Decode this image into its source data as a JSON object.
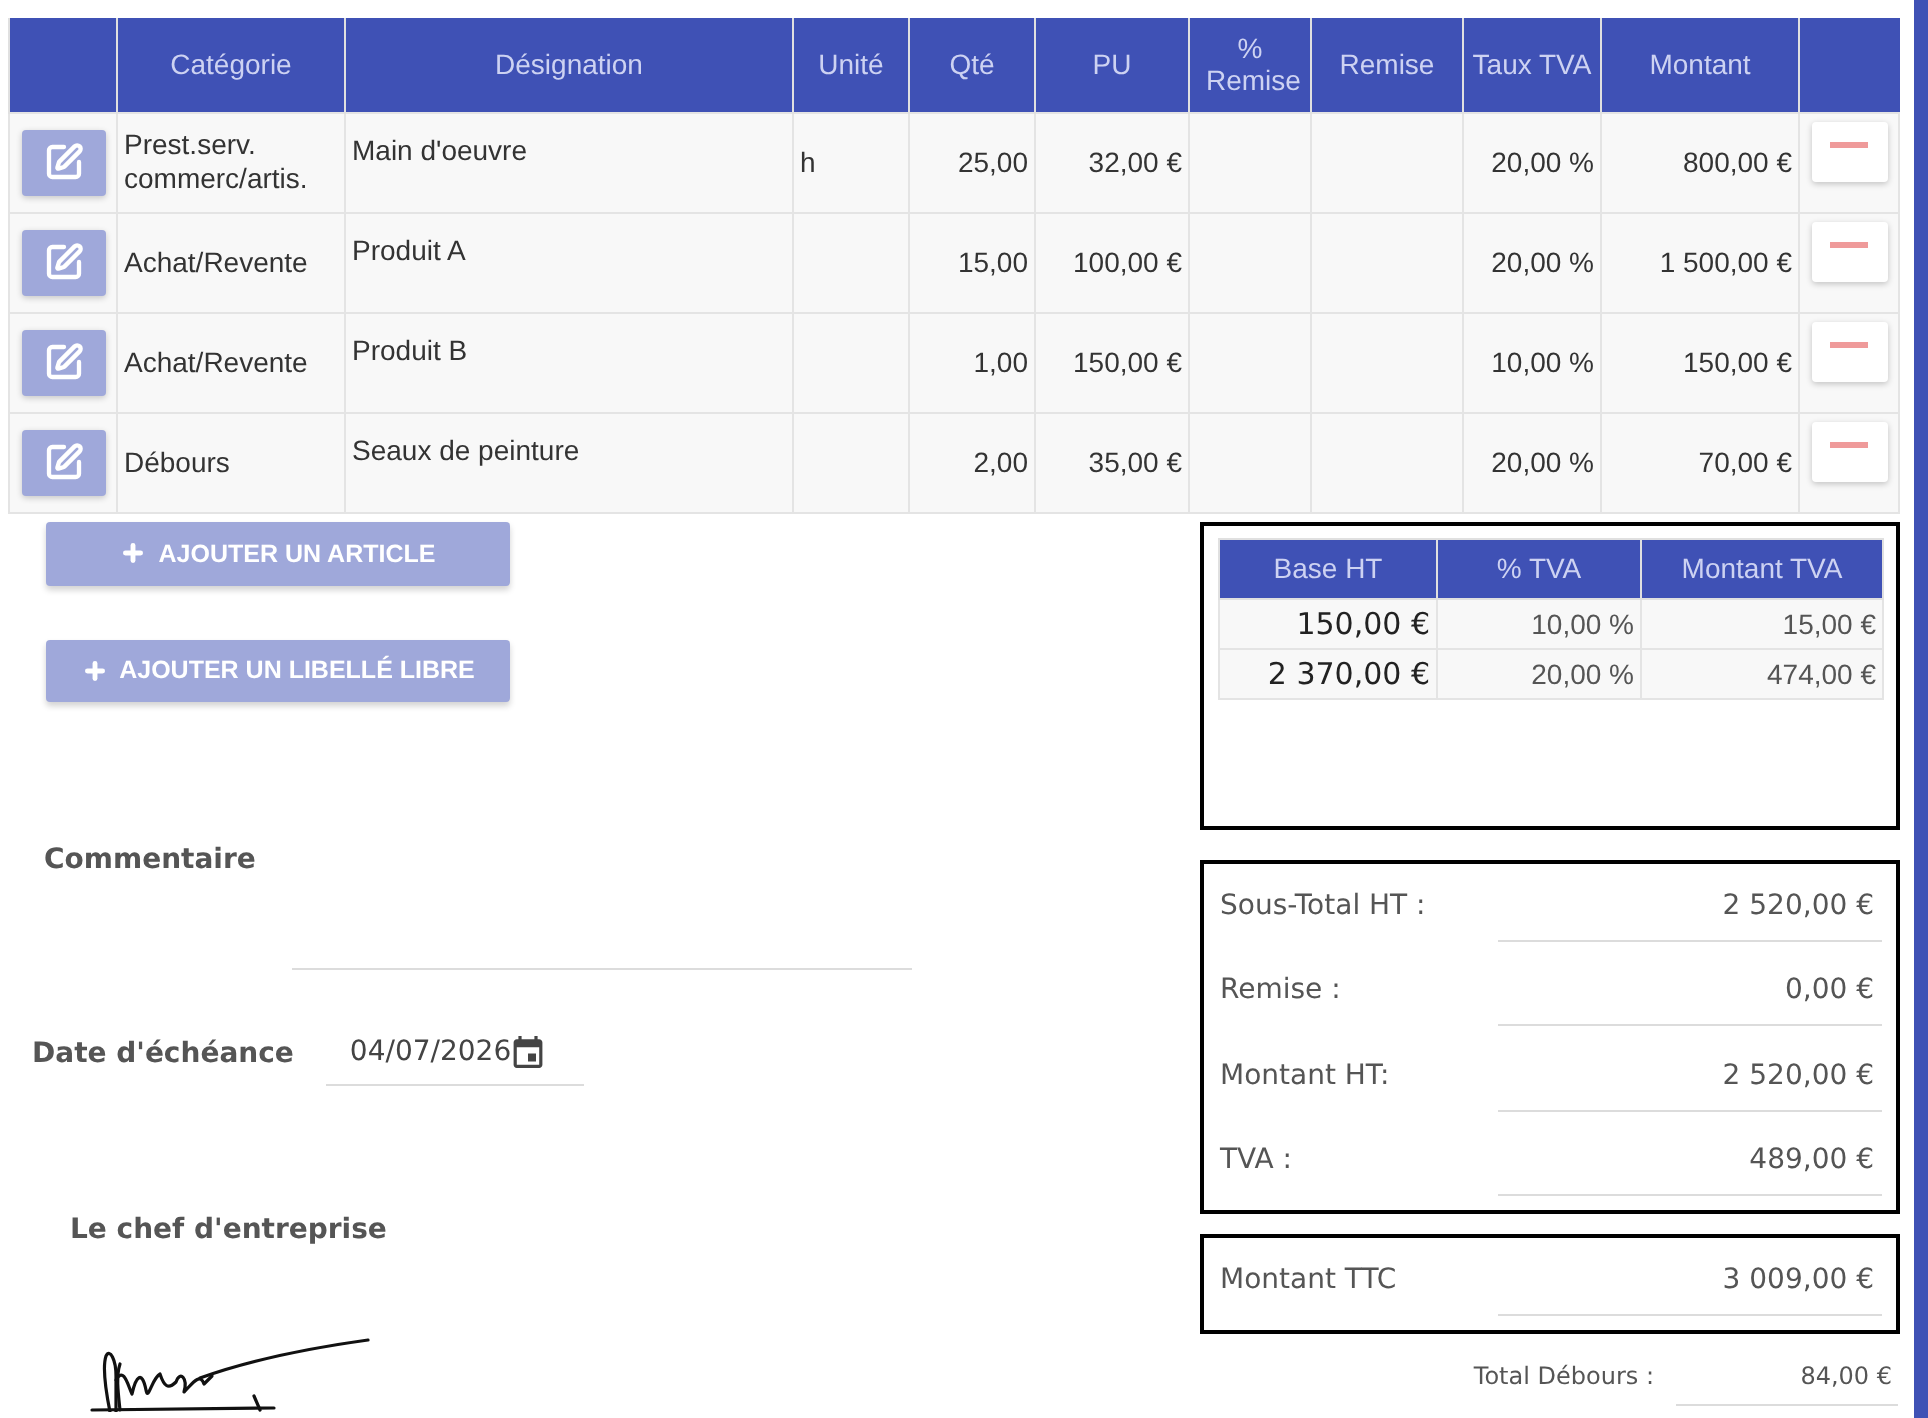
{
  "table": {
    "columns": [
      {
        "label": "Catégorie"
      },
      {
        "label": "Désignation"
      },
      {
        "label": "Unité"
      },
      {
        "label": "Qté"
      },
      {
        "label": "PU"
      },
      {
        "label": "% Remise"
      },
      {
        "label": "Remise"
      },
      {
        "label": "Taux TVA"
      },
      {
        "label": "Montant"
      }
    ],
    "rows": [
      {
        "category": "Prest.serv. commerc/artis.",
        "designation": "Main d'oeuvre",
        "unit": "h",
        "quantity": "25,00",
        "unit_price": "32,00 €",
        "vat_rate": "20,00 %",
        "amount": "800,00 €"
      },
      {
        "category": "Achat/Revente",
        "designation": "Produit A",
        "quantity": "15,00",
        "unit_price": "100,00 €",
        "vat_rate": "20,00 %",
        "amount": "1 500,00 €"
      },
      {
        "category": "Achat/Revente",
        "designation": "Produit B",
        "quantity": "1,00",
        "unit_price": "150,00 €",
        "vat_rate": "10,00 %",
        "amount": "150,00 €"
      },
      {
        "category": "Débours",
        "designation": "Seaux de peinture",
        "quantity": "2,00",
        "unit_price": "35,00 €",
        "vat_rate": "20,00 %",
        "amount": "70,00 €"
      }
    ]
  },
  "actions": [
    {
      "label": "AJOUTER UN ARTICLE"
    },
    {
      "label": "AJOUTER UN LIBELLÉ LIBRE"
    }
  ],
  "vat_summary": {
    "columns": [
      {
        "label": "Base HT"
      },
      {
        "label": "% TVA"
      },
      {
        "label": "Montant TVA"
      }
    ],
    "rows": [
      {
        "base": "150,00 €",
        "rate": "10,00 %",
        "amount": "15,00 €"
      },
      {
        "base": "2 370,00 €",
        "rate": "20,00 %",
        "amount": "474,00 €"
      }
    ]
  },
  "comment": {
    "label": "Commentaire"
  },
  "totals": [
    {
      "label": "Sous-Total HT :",
      "value": "2 520,00 €"
    },
    {
      "label": "Remise :",
      "value": "0,00 €"
    },
    {
      "label": "Montant HT:",
      "value": "2 520,00 €"
    },
    {
      "label": "TVA :",
      "value": "489,00 €"
    }
  ],
  "due_date": {
    "label": "Date d'échéance",
    "value": "04/07/2026"
  },
  "signature": {
    "label": "Le chef d'entreprise"
  },
  "total_ttc": {
    "label": "Montant TTC",
    "value": "3 009,00 €"
  },
  "total_debours": {
    "label": "Total Débours :",
    "value": "84,00 €"
  }
}
